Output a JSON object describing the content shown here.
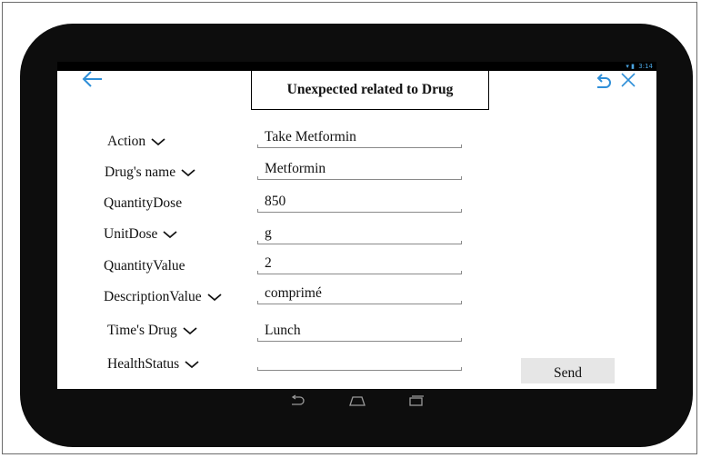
{
  "status": {
    "time": "3:14",
    "icons": "▾ ▮"
  },
  "header": {
    "title": "Unexpected  related to Drug"
  },
  "form": {
    "rows": [
      {
        "label": "Action",
        "dropdown": true,
        "value": "Take Metformin"
      },
      {
        "label": "Drug's  name",
        "dropdown": true,
        "value": "Metformin"
      },
      {
        "label": "QuantityDose",
        "dropdown": false,
        "value": "850"
      },
      {
        "label": "UnitDose",
        "dropdown": true,
        "value": "g"
      },
      {
        "label": "QuantityValue",
        "dropdown": false,
        "value": "2"
      },
      {
        "label": "DescriptionValue",
        "dropdown": true,
        "value": "comprimé"
      },
      {
        "label": "Time's Drug",
        "dropdown": true,
        "value": "Lunch"
      },
      {
        "label": "HealthStatus",
        "dropdown": true,
        "value": ""
      }
    ],
    "send_label": "Send"
  },
  "icons": {
    "back": "back-arrow-icon",
    "undo": "undo-icon",
    "close": "close-icon",
    "nav_back": "nav-back-icon",
    "nav_home": "nav-home-icon",
    "nav_recents": "nav-recents-icon"
  },
  "colors": {
    "accent": "#2f8fd8",
    "bezel": "#0d0d0d",
    "button": "#e6e6e6"
  }
}
